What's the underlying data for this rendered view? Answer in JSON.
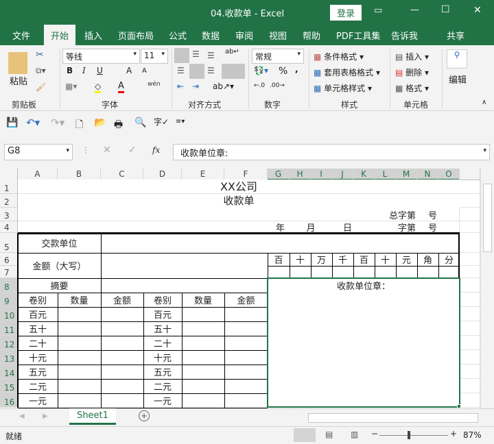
{
  "window": {
    "title": "04.收款单  -  Excel",
    "login": "登录",
    "minimize": "—",
    "restore": "☐",
    "close": "✕"
  },
  "menu": [
    {
      "label": "文件"
    },
    {
      "label": "开始",
      "active": true
    },
    {
      "label": "插入"
    },
    {
      "label": "页面布局"
    },
    {
      "label": "公式"
    },
    {
      "label": "数据"
    },
    {
      "label": "审阅"
    },
    {
      "label": "视图"
    },
    {
      "label": "帮助"
    },
    {
      "label": "PDF工具集"
    },
    {
      "label": "告诉我"
    },
    {
      "label": "共享"
    }
  ],
  "ribbon": {
    "paste": "粘贴",
    "font_name": "等线",
    "font_size": "11",
    "bold": "B",
    "italic": "I",
    "underline": "U",
    "grow": "A",
    "shrink": "A",
    "wen": "wén",
    "number_format": "常规",
    "percent": "%",
    "comma": ",",
    "cond_format": "条件格式",
    "table_format": "套用表格格式",
    "cell_style": "单元格样式",
    "insert": "插入",
    "delete": "删除",
    "format": "格式",
    "edit": "编辑",
    "groups": {
      "clipboard": "剪贴板",
      "font": "字体",
      "align": "对齐方式",
      "number": "数字",
      "styles": "样式",
      "cells": "单元格"
    }
  },
  "formula_bar": {
    "name_box": "G8",
    "fx": "fx",
    "value": "收款单位章:"
  },
  "columns": [
    "A",
    "B",
    "C",
    "D",
    "E",
    "F",
    "G",
    "H",
    "I",
    "J",
    "K",
    "L",
    "M",
    "N",
    "O"
  ],
  "selected_columns": [
    "G",
    "H",
    "I",
    "J",
    "K",
    "L",
    "M",
    "N",
    "O"
  ],
  "rows": [
    "1",
    "2",
    "3",
    "4",
    "5",
    "6",
    "7",
    "8",
    "9",
    "10",
    "11",
    "12",
    "13",
    "14",
    "15",
    "16"
  ],
  "selected_rows": [
    "8",
    "9",
    "10",
    "11",
    "12",
    "13",
    "14",
    "15",
    "16"
  ],
  "sheet": {
    "company": "XX公司",
    "title": "收款单",
    "total_no": "总字第",
    "no_suffix": "号",
    "zi_no": "字第",
    "year": "年",
    "month": "月",
    "day": "日",
    "payer": "交款单位",
    "amount": "金额（大写）",
    "digits": [
      "百",
      "十",
      "万",
      "千",
      "百",
      "十",
      "元",
      "角",
      "分"
    ],
    "summary": "摘要",
    "stamp": "收款单位章：",
    "headers": [
      "卷别",
      "数量",
      "金额",
      "卷别",
      "数量",
      "金额"
    ],
    "denoms": [
      "百元",
      "五十",
      "二十",
      "十元",
      "五元",
      "二元",
      "一元"
    ]
  },
  "tabs": {
    "sheet1": "Sheet1",
    "add": "+"
  },
  "status": {
    "ready": "就绪",
    "zoom": "87%",
    "minus": "−",
    "plus": "+"
  }
}
